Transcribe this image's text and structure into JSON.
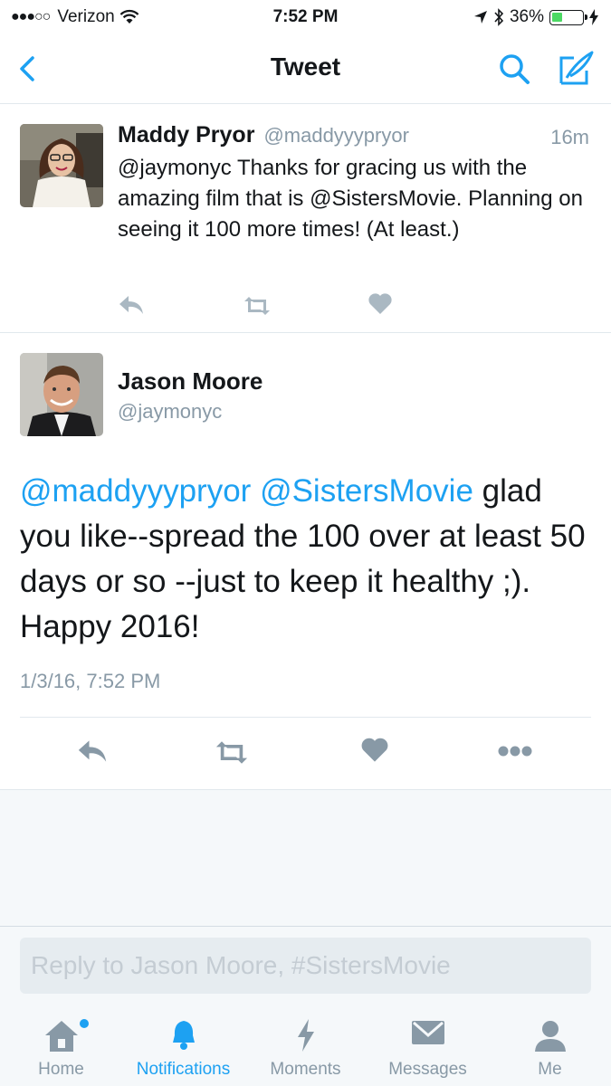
{
  "status_bar": {
    "carrier": "Verizon",
    "time": "7:52 PM",
    "battery": "36%",
    "battery_level": 0.36
  },
  "nav": {
    "title": "Tweet"
  },
  "parent_tweet": {
    "name": "Maddy Pryor",
    "handle": "@maddyyypryor",
    "time_ago": "16m",
    "text": "@jaymonyc Thanks for gracing us with the amazing film that is @SistersMovie. Planning on seeing it 100 more times! (At least.)"
  },
  "main_tweet": {
    "name": "Jason Moore",
    "handle": "@jaymonyc",
    "mention1": "@maddyyypryor",
    "mention2": "@SistersMovie",
    "text": " glad you like--spread the 100 over at least 50 days or so --just to keep it healthy ;). Happy 2016!",
    "timestamp": "1/3/16, 7:52 PM"
  },
  "reply": {
    "placeholder": "Reply to Jason Moore, #SistersMovie"
  },
  "tabbar": {
    "home": "Home",
    "notifications": "Notifications",
    "moments": "Moments",
    "messages": "Messages",
    "me": "Me",
    "active": "notifications"
  },
  "colors": {
    "accent": "#1da1f2",
    "muted": "#8899a6",
    "text": "#14171a"
  }
}
